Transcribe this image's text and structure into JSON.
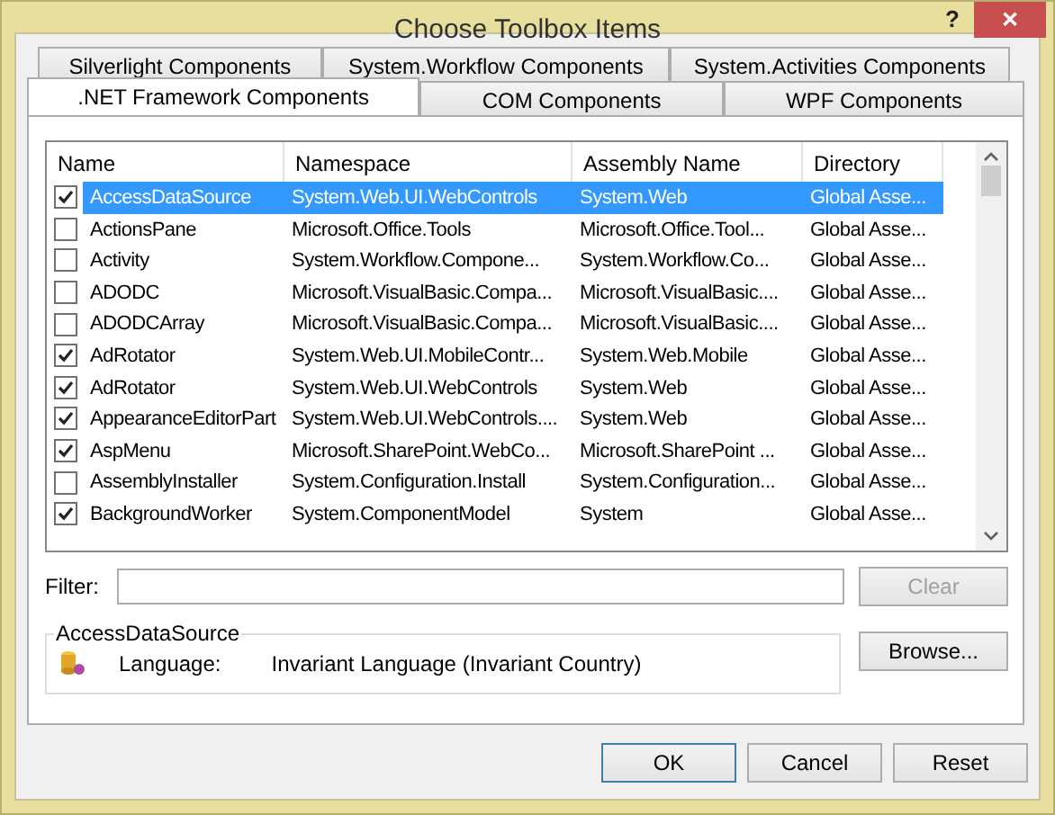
{
  "window": {
    "title": "Choose Toolbox Items",
    "help": "?",
    "close": "✕"
  },
  "tab_rows": [
    {
      "tabs": [
        {
          "label": "Silverlight Components",
          "selected": false
        },
        {
          "label": "System.Workflow Components",
          "selected": false
        },
        {
          "label": "System.Activities Components",
          "selected": false
        }
      ]
    },
    {
      "tabs": [
        {
          "label": ".NET Framework Components",
          "selected": true
        },
        {
          "label": "COM Components",
          "selected": false
        },
        {
          "label": "WPF Components",
          "selected": false
        }
      ]
    }
  ],
  "table": {
    "columns": [
      "Name",
      "Namespace",
      "Assembly Name",
      "Directory"
    ],
    "rows": [
      {
        "name": "AccessDataSource",
        "namespace": "System.Web.UI.WebControls",
        "assembly": "System.Web",
        "directory": "Global Asse...",
        "checked": true,
        "selected": true
      },
      {
        "name": "ActionsPane",
        "namespace": "Microsoft.Office.Tools",
        "assembly": "Microsoft.Office.Tool...",
        "directory": "Global Asse...",
        "checked": false,
        "selected": false
      },
      {
        "name": "Activity",
        "namespace": "System.Workflow.Compone...",
        "assembly": "System.Workflow.Co...",
        "directory": "Global Asse...",
        "checked": false,
        "selected": false
      },
      {
        "name": "ADODC",
        "namespace": "Microsoft.VisualBasic.Compa...",
        "assembly": "Microsoft.VisualBasic....",
        "directory": "Global Asse...",
        "checked": false,
        "selected": false
      },
      {
        "name": "ADODCArray",
        "namespace": "Microsoft.VisualBasic.Compa...",
        "assembly": "Microsoft.VisualBasic....",
        "directory": "Global Asse...",
        "checked": false,
        "selected": false
      },
      {
        "name": "AdRotator",
        "namespace": "System.Web.UI.MobileContr...",
        "assembly": "System.Web.Mobile",
        "directory": "Global Asse...",
        "checked": true,
        "selected": false
      },
      {
        "name": "AdRotator",
        "namespace": "System.Web.UI.WebControls",
        "assembly": "System.Web",
        "directory": "Global Asse...",
        "checked": true,
        "selected": false
      },
      {
        "name": "AppearanceEditorPart",
        "namespace": "System.Web.UI.WebControls....",
        "assembly": "System.Web",
        "directory": "Global Asse...",
        "checked": true,
        "selected": false
      },
      {
        "name": "AspMenu",
        "namespace": "Microsoft.SharePoint.WebCo...",
        "assembly": "Microsoft.SharePoint ...",
        "directory": "Global Asse...",
        "checked": true,
        "selected": false
      },
      {
        "name": "AssemblyInstaller",
        "namespace": "System.Configuration.Install",
        "assembly": "System.Configuration...",
        "directory": "Global Asse...",
        "checked": false,
        "selected": false
      },
      {
        "name": "BackgroundWorker",
        "namespace": "System.ComponentModel",
        "assembly": "System",
        "directory": "Global Asse...",
        "checked": true,
        "selected": false
      }
    ]
  },
  "filter": {
    "label": "Filter:",
    "clear": "Clear"
  },
  "details": {
    "title": "AccessDataSource",
    "label": "Language:",
    "value": "Invariant Language (Invariant Country)"
  },
  "browse": "Browse...",
  "buttons": [
    "OK",
    "Cancel",
    "Reset"
  ]
}
